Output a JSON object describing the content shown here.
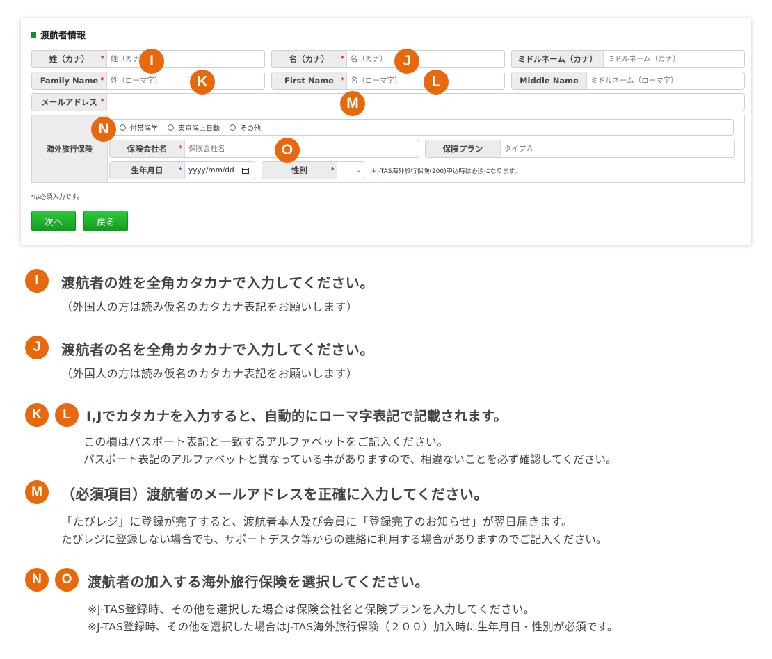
{
  "form": {
    "section_title": "渡航者情報",
    "required_mark": "*",
    "fields": {
      "last_kana": {
        "label": "姓（カナ）",
        "placeholder": "姓（カナ）"
      },
      "first_kana": {
        "label": "名（カナ）",
        "placeholder": "名（カナ）"
      },
      "middle_kana": {
        "label": "ミドルネーム（カナ）",
        "placeholder": "ミドルネーム（カナ）"
      },
      "family_name": {
        "label": "Family Name",
        "placeholder": "姓（ローマ字）"
      },
      "first_name": {
        "label": "First Name",
        "placeholder": "名（ローマ字）"
      },
      "middle_name": {
        "label": "Middle Name",
        "placeholder": "ミドルネーム（ローマ字）"
      },
      "email": {
        "label": "メールアドレス",
        "placeholder": ""
      }
    },
    "insurance": {
      "label": "海外旅行保険",
      "options": [
        "付帯海学",
        "東京海上日動",
        "その他"
      ],
      "company": {
        "label": "保険会社名",
        "placeholder": "保険会社名"
      },
      "plan": {
        "label": "保険プラン",
        "placeholder": "タイプＡ"
      },
      "birthdate": {
        "label": "生年月日",
        "placeholder": "yyyy/mm/dd"
      },
      "gender": {
        "label": "性別",
        "value": ""
      },
      "note": "J-TAS海外旅行保険(200)申込時は必須になります。"
    },
    "required_note": "は必須入力です。",
    "buttons": {
      "next": "次へ",
      "back": "戻る"
    }
  },
  "markers": {
    "I": "I",
    "J": "J",
    "K": "K",
    "L": "L",
    "M": "M",
    "N": "N",
    "O": "O"
  },
  "explanations": {
    "i": {
      "heading": "渡航者の姓を全角カタカナで入力してください。",
      "lines": [
        "（外国人の方は読み仮名のカタカナ表記をお願いします）"
      ]
    },
    "j": {
      "heading": "渡航者の名を全角カタカナで入力してください。",
      "lines": [
        "（外国人の方は読み仮名のカタカナ表記をお願いします）"
      ]
    },
    "kl": {
      "heading": "I,Jでカタカナを入力すると、自動的にローマ字表記で記載されます。",
      "lines": [
        "この欄はパスポート表記と一致するアルファベットをご記入ください。",
        "パスポート表記のアルファベットと異なっている事がありますので、相違ないことを必ず確認してください。"
      ]
    },
    "m": {
      "heading": "（必須項目）渡航者のメールアドレスを正確に入力してください。",
      "lines": [
        "「たびレジ」に登録が完了すると、渡航者本人及び会員に「登録完了のお知らせ」が翌日届きます。",
        "たびレジに登録しない場合でも、サポートデスク等からの連絡に利用する場合がありますのでご記入ください。"
      ]
    },
    "no": {
      "heading": "渡航者の加入する海外旅行保険を選択してください。",
      "lines": [
        "※J-TAS登録時、その他を選択した場合は保険会社名と保険プランを入力してください。",
        "※J-TAS登録時、その他を選択した場合はJ-TAS海外旅行保険（２００）加入時に生年月日・性別が必須です。"
      ]
    }
  }
}
